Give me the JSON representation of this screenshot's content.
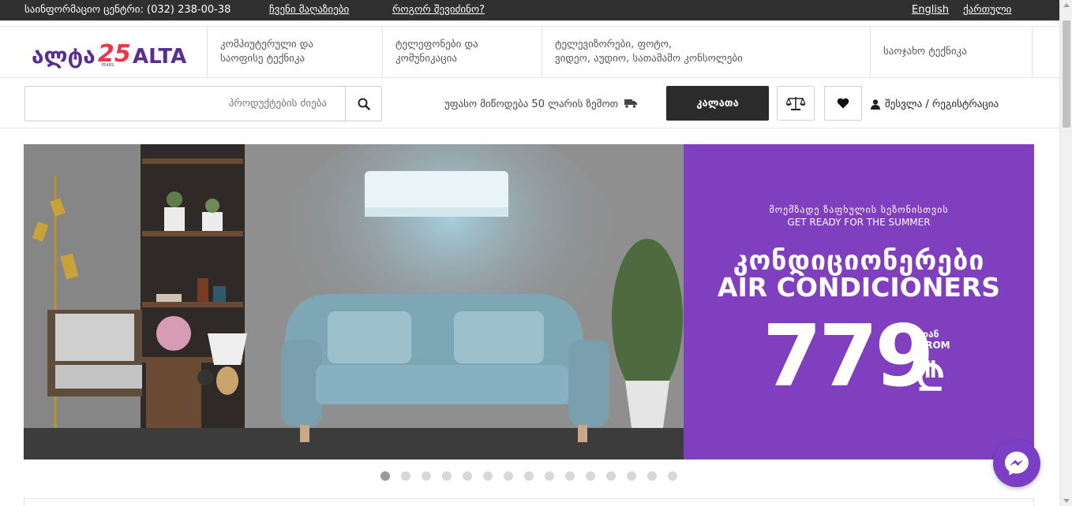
{
  "topbar": {
    "info_center": "საინფორმაციო ცენტრი: (032) 238-00-38",
    "stores_link": "ჩვენი მაღაზიები",
    "how_to_buy_link": "როგორ შევიძინო?",
    "lang_en": "English",
    "lang_ka": "ქართული"
  },
  "logo": {
    "text_ka": "ალტა",
    "years": "25",
    "years_sub": "YEARS",
    "text_en": "ALTA"
  },
  "categories": [
    {
      "line1": "კომპიუტერული და",
      "line2": "საოფისე ტექნიკა"
    },
    {
      "line1": "ტელეფონები და",
      "line2": "კომუნიკაცია"
    },
    {
      "line1": "ტელევიზორები, ფოტო,",
      "line2": "ვიდეო, აუდიო, სათამაშო კონსოლები"
    },
    {
      "line1": "საოჯახო ტექნიკა",
      "line2": ""
    }
  ],
  "search": {
    "placeholder": "პროდუქტების ძიება"
  },
  "delivery_text": "უფასო მიწოდება 50 ლარის ზემოთ",
  "cart_label": "კალათა",
  "login_label": "შესვლა / რეგისტრაცია",
  "banner": {
    "subtitle_ka": "მოემზადე ზაფხულის სეზონისთვის",
    "subtitle_en": "GET READY FOR THE SUMMER",
    "title_ka": "კონდიციონერები",
    "title_en": "AIR CONDICIONERS",
    "price": "779",
    "from_ka": "დან",
    "from_en": "FROM",
    "currency": "₾"
  },
  "carousel": {
    "total_dots": 15,
    "active_index": 0
  },
  "colors": {
    "brand_purple": "#7f3fbf",
    "topbar_bg": "#303030",
    "cart_bg": "#2b2b2b",
    "logo_purple": "#5a2d91",
    "logo_red": "#e8374a"
  },
  "icons": [
    "search-icon",
    "truck-icon",
    "scales-icon",
    "heart-icon",
    "user-icon",
    "messenger-icon"
  ]
}
